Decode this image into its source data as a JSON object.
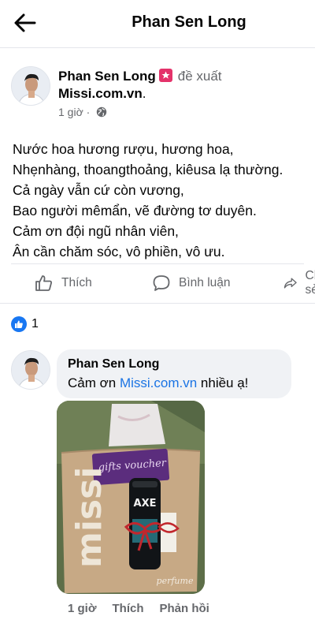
{
  "topbar": {
    "title": "Phan Sen Long"
  },
  "post": {
    "author": "Phan Sen Long",
    "suggest_text": "đề xuất",
    "site": "Missi.com.vn",
    "site_suffix": ".",
    "time": "1 giờ ·",
    "poem": [
      "Nước hoa hương rượu, hương hoa,",
      "Nhẹnhàng, thoangthoảng, kiêusa lạ thường.",
      "Cả ngày vẫn cứ còn vương,",
      "Bao người mêmẩn, vẽ đường tơ duyên.",
      "Cảm ơn đội ngũ nhân viên,",
      "Ân cần chăm sóc, vô phiền, vô ưu."
    ],
    "actions": {
      "like": "Thích",
      "comment": "Bình luận",
      "share": "Chia sẻ"
    }
  },
  "reactions": {
    "count": "1"
  },
  "comment": {
    "author": "Phan Sen Long",
    "text_before": "Cảm ơn ",
    "link": "Missi.com.vn",
    "text_after": " nhiều ạ!",
    "time": "1 giờ",
    "like": "Thích",
    "reply": "Phản hồi",
    "photo_text": {
      "brand": "missi",
      "voucher": "gifts voucher",
      "product": "AXE",
      "script": "perfume"
    }
  },
  "colors": {
    "accent": "#1877f2",
    "link": "#1b74e4",
    "badge": "#e4326a",
    "muted": "#65676b"
  }
}
